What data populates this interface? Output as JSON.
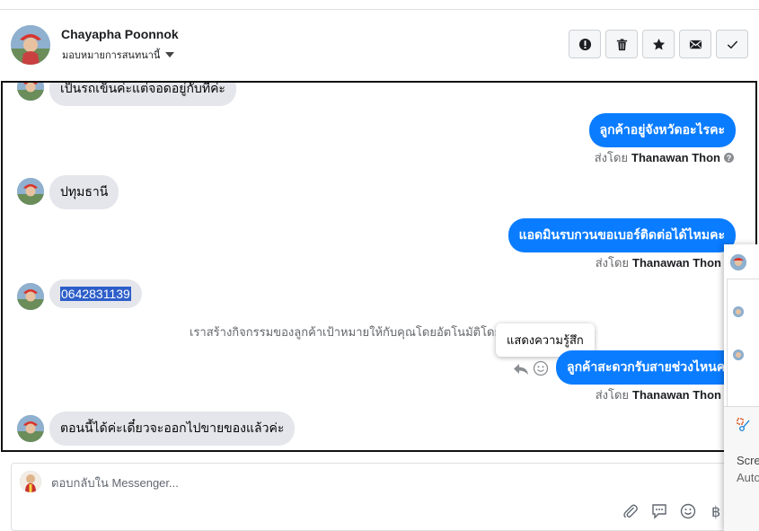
{
  "header": {
    "contact_name": "Chayapha Poonnok",
    "assign_label": "มอบหมายการสนทนานี้"
  },
  "toolbar": {
    "buttons": [
      {
        "icon": "exclamation-icon"
      },
      {
        "icon": "trash-icon"
      },
      {
        "icon": "star-icon"
      },
      {
        "icon": "envelope-icon"
      },
      {
        "icon": "checkmark-icon"
      }
    ]
  },
  "thread": {
    "messages": [
      {
        "dir": "in",
        "text": "เป็นรถเข็นค่ะแต่จอดอยู่กับที่ค่ะ"
      },
      {
        "dir": "out",
        "text": "ลูกค้าอยู่จังหวัดอะไรคะ",
        "sent_by_prefix": "ส่งโดย",
        "sent_by": "Thanawan Thon"
      },
      {
        "dir": "in",
        "text": "ปทุมธานี"
      },
      {
        "dir": "out",
        "text": "แอดมินรบกวนขอเบอร์ติดต่อได้ไหมคะ",
        "sent_by_prefix": "ส่งโดย",
        "sent_by": "Thanawan Thon"
      },
      {
        "dir": "in",
        "text": "0642831139"
      },
      {
        "dir": "out",
        "text": "ลูกค้าสะดวกรับสายช่วงไหนคะ",
        "sent_by_prefix": "ส่งโดย",
        "sent_by": "Thanawan Thon"
      },
      {
        "dir": "in",
        "text": "ตอนนี้ได้ค่ะเดี๋ยวจะออกไปขายของแล้วค่ะ"
      }
    ],
    "system_note": "เราสร้างกิจกรรมของลูกค้าเป้าหมายให้กับคุณโดยอัตโนมัติโดยอิงตา",
    "tooltip": "แสดงความรู้สึก"
  },
  "composer": {
    "placeholder": "ตอบกลับใน Messenger...",
    "tools": [
      "paperclip-icon",
      "chat-template-icon",
      "emoji-icon",
      "baht-icon"
    ]
  },
  "side_panel": {
    "popup_text_1": "Scre",
    "popup_text_2": "Auto"
  },
  "colors": {
    "accent": "#0a7cff",
    "incoming_bubble": "#e4e6eb",
    "selection": "#2d5ec9"
  }
}
